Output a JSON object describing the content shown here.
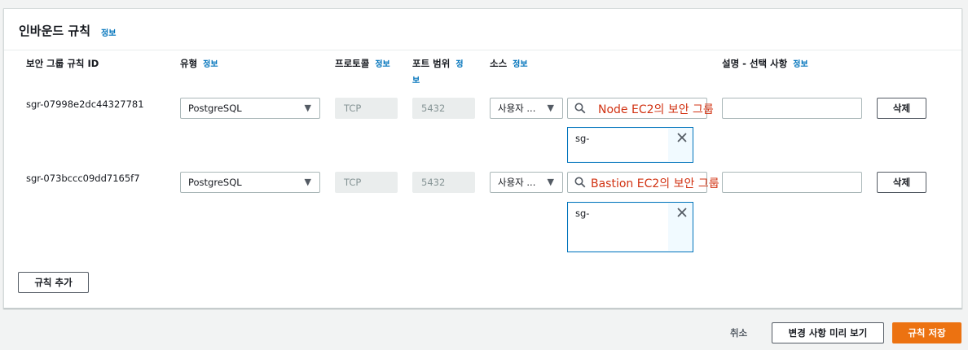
{
  "panel": {
    "title": "인바운드 규칙",
    "info": "정보"
  },
  "columns": {
    "rule_id": "보안 그룹 규칙 ID",
    "type": "유형",
    "type_info": "정보",
    "protocol": "프로토콜",
    "protocol_info": "정보",
    "port_range_a": "포트 범위",
    "port_range_info_a": "정",
    "port_range_info_b": "보",
    "source": "소스",
    "source_info": "정보",
    "description": "설명 - 선택 사항",
    "description_info": "정보"
  },
  "rules": [
    {
      "id": "sgr-07998e2dc44327781",
      "type": "PostgreSQL",
      "protocol": "TCP",
      "port": "5432",
      "source_type": "사용자 ...",
      "search_note": "Node EC2의 보안 그룹",
      "token": "sg-",
      "description": "",
      "delete_label": "삭제"
    },
    {
      "id": "sgr-073bccc09dd7165f7",
      "type": "PostgreSQL",
      "protocol": "TCP",
      "port": "5432",
      "source_type": "사용자 ...",
      "search_note": "Bastion EC2의 보안 그룹",
      "token": "sg-",
      "description": "",
      "delete_label": "삭제"
    }
  ],
  "add_rule_label": "규칙 추가",
  "footer": {
    "cancel": "취소",
    "preview": "변경 사항 미리 보기",
    "save": "규칙 저장"
  },
  "colors": {
    "accent": "#ec7211",
    "link": "#0073bb",
    "annotation": "#d13212"
  }
}
